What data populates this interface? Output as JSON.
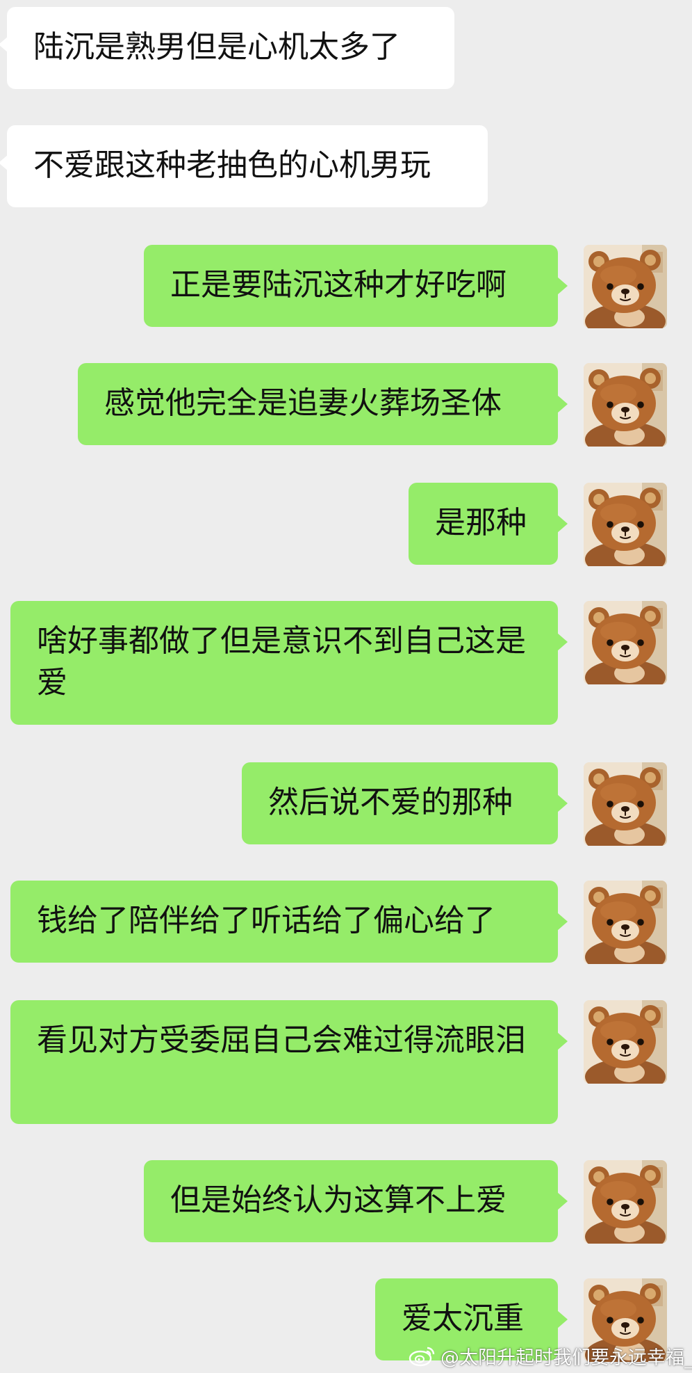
{
  "colors": {
    "background": "#ededed",
    "incoming_bubble": "#ffffff",
    "outgoing_bubble": "#95ec69",
    "text": "#111111"
  },
  "messages": [
    {
      "direction": "incoming",
      "text": "陆沉是熟男但是心机太多了"
    },
    {
      "direction": "incoming",
      "text": "不爱跟这种老抽色的心机男玩"
    },
    {
      "direction": "outgoing",
      "text": "正是要陆沉这种才好吃啊",
      "avatar": "bear-plush-avatar"
    },
    {
      "direction": "outgoing",
      "text": "感觉他完全是追妻火葬场圣体",
      "avatar": "bear-plush-avatar"
    },
    {
      "direction": "outgoing",
      "text": "是那种",
      "avatar": "bear-plush-avatar"
    },
    {
      "direction": "outgoing",
      "text": "啥好事都做了但是意识不到自己这是爱",
      "avatar": "bear-plush-avatar"
    },
    {
      "direction": "outgoing",
      "text": "然后说不爱的那种",
      "avatar": "bear-plush-avatar"
    },
    {
      "direction": "outgoing",
      "text": "钱给了陪伴给了听话给了偏心给了",
      "avatar": "bear-plush-avatar"
    },
    {
      "direction": "outgoing",
      "text": "看见对方受委屈自己会难过得流眼泪",
      "avatar": "bear-plush-avatar"
    },
    {
      "direction": "outgoing",
      "text": "但是始终认为这算不上爱",
      "avatar": "bear-plush-avatar"
    },
    {
      "direction": "outgoing",
      "text": "爱太沉重",
      "avatar": "bear-plush-avatar"
    }
  ],
  "watermark": {
    "icon": "weibo-icon",
    "text": "@太阳升起时我们要永远幸福_"
  }
}
